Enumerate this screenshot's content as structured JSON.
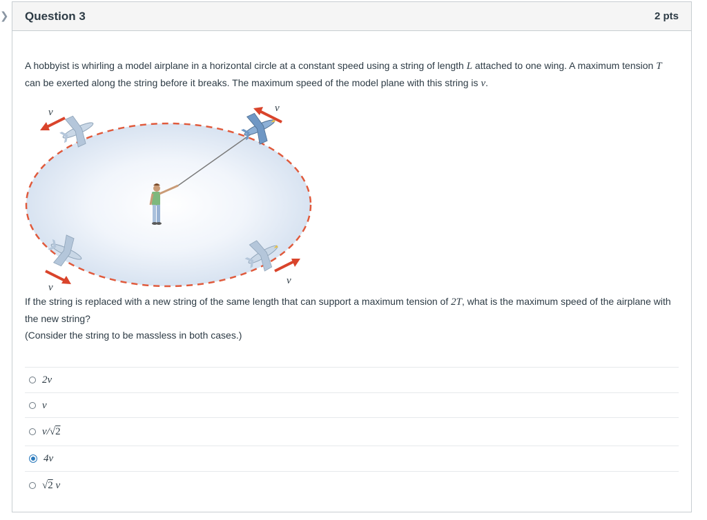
{
  "question": {
    "title": "Question 3",
    "points": "2 pts",
    "paragraph1": {
      "a": "A hobbyist is whirling a model airplane in a horizontal circle at a constant speed using a string of length ",
      "L": "L",
      "b": " attached to one wing. A maximum tension ",
      "T": "T",
      "c": " can be exerted along the string before it breaks. The maximum speed of the model plane with this string is ",
      "v": "v",
      "d": "."
    },
    "figure": {
      "velocity_labels": [
        "v",
        "v",
        "v",
        "v"
      ]
    },
    "paragraph2": {
      "a": "If the string is replaced with a new string of the same length that can support a maximum tension of ",
      "T2": "2T",
      "b": ", what is the maximum speed of the airplane with the new string?"
    },
    "paragraph3": "(Consider the string to be massless in both cases.)",
    "answers": [
      {
        "label": "2v",
        "selected": false
      },
      {
        "label": "v",
        "selected": false
      },
      {
        "label_pre": "v/",
        "label_radical": "√",
        "label_rad": "2",
        "selected": false
      },
      {
        "label": "4v",
        "selected": true
      },
      {
        "label_radical": "√",
        "label_rad": "2",
        "label_post": " v",
        "selected": false
      }
    ]
  },
  "colors": {
    "border": "#c7cdd1",
    "header_bg": "#f5f5f5",
    "text": "#2d3b45",
    "radio_selected": "#2b7abc",
    "arrow": "#d9442b",
    "path_dash": "#e05a3c",
    "disc": "#e7eef8"
  },
  "icons": [
    "chevron-right-icon",
    "airplane-icon",
    "person-icon"
  ]
}
